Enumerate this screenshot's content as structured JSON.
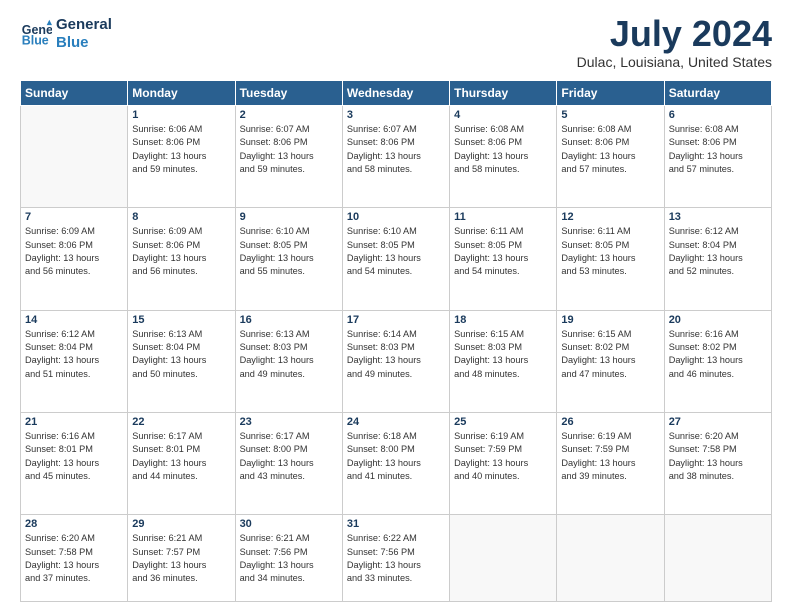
{
  "header": {
    "logo_line1": "General",
    "logo_line2": "Blue",
    "month_title": "July 2024",
    "location": "Dulac, Louisiana, United States"
  },
  "weekdays": [
    "Sunday",
    "Monday",
    "Tuesday",
    "Wednesday",
    "Thursday",
    "Friday",
    "Saturday"
  ],
  "weeks": [
    [
      {
        "day": "",
        "info": ""
      },
      {
        "day": "1",
        "info": "Sunrise: 6:06 AM\nSunset: 8:06 PM\nDaylight: 13 hours\nand 59 minutes."
      },
      {
        "day": "2",
        "info": "Sunrise: 6:07 AM\nSunset: 8:06 PM\nDaylight: 13 hours\nand 59 minutes."
      },
      {
        "day": "3",
        "info": "Sunrise: 6:07 AM\nSunset: 8:06 PM\nDaylight: 13 hours\nand 58 minutes."
      },
      {
        "day": "4",
        "info": "Sunrise: 6:08 AM\nSunset: 8:06 PM\nDaylight: 13 hours\nand 58 minutes."
      },
      {
        "day": "5",
        "info": "Sunrise: 6:08 AM\nSunset: 8:06 PM\nDaylight: 13 hours\nand 57 minutes."
      },
      {
        "day": "6",
        "info": "Sunrise: 6:08 AM\nSunset: 8:06 PM\nDaylight: 13 hours\nand 57 minutes."
      }
    ],
    [
      {
        "day": "7",
        "info": "Sunrise: 6:09 AM\nSunset: 8:06 PM\nDaylight: 13 hours\nand 56 minutes."
      },
      {
        "day": "8",
        "info": "Sunrise: 6:09 AM\nSunset: 8:06 PM\nDaylight: 13 hours\nand 56 minutes."
      },
      {
        "day": "9",
        "info": "Sunrise: 6:10 AM\nSunset: 8:05 PM\nDaylight: 13 hours\nand 55 minutes."
      },
      {
        "day": "10",
        "info": "Sunrise: 6:10 AM\nSunset: 8:05 PM\nDaylight: 13 hours\nand 54 minutes."
      },
      {
        "day": "11",
        "info": "Sunrise: 6:11 AM\nSunset: 8:05 PM\nDaylight: 13 hours\nand 54 minutes."
      },
      {
        "day": "12",
        "info": "Sunrise: 6:11 AM\nSunset: 8:05 PM\nDaylight: 13 hours\nand 53 minutes."
      },
      {
        "day": "13",
        "info": "Sunrise: 6:12 AM\nSunset: 8:04 PM\nDaylight: 13 hours\nand 52 minutes."
      }
    ],
    [
      {
        "day": "14",
        "info": "Sunrise: 6:12 AM\nSunset: 8:04 PM\nDaylight: 13 hours\nand 51 minutes."
      },
      {
        "day": "15",
        "info": "Sunrise: 6:13 AM\nSunset: 8:04 PM\nDaylight: 13 hours\nand 50 minutes."
      },
      {
        "day": "16",
        "info": "Sunrise: 6:13 AM\nSunset: 8:03 PM\nDaylight: 13 hours\nand 49 minutes."
      },
      {
        "day": "17",
        "info": "Sunrise: 6:14 AM\nSunset: 8:03 PM\nDaylight: 13 hours\nand 49 minutes."
      },
      {
        "day": "18",
        "info": "Sunrise: 6:15 AM\nSunset: 8:03 PM\nDaylight: 13 hours\nand 48 minutes."
      },
      {
        "day": "19",
        "info": "Sunrise: 6:15 AM\nSunset: 8:02 PM\nDaylight: 13 hours\nand 47 minutes."
      },
      {
        "day": "20",
        "info": "Sunrise: 6:16 AM\nSunset: 8:02 PM\nDaylight: 13 hours\nand 46 minutes."
      }
    ],
    [
      {
        "day": "21",
        "info": "Sunrise: 6:16 AM\nSunset: 8:01 PM\nDaylight: 13 hours\nand 45 minutes."
      },
      {
        "day": "22",
        "info": "Sunrise: 6:17 AM\nSunset: 8:01 PM\nDaylight: 13 hours\nand 44 minutes."
      },
      {
        "day": "23",
        "info": "Sunrise: 6:17 AM\nSunset: 8:00 PM\nDaylight: 13 hours\nand 43 minutes."
      },
      {
        "day": "24",
        "info": "Sunrise: 6:18 AM\nSunset: 8:00 PM\nDaylight: 13 hours\nand 41 minutes."
      },
      {
        "day": "25",
        "info": "Sunrise: 6:19 AM\nSunset: 7:59 PM\nDaylight: 13 hours\nand 40 minutes."
      },
      {
        "day": "26",
        "info": "Sunrise: 6:19 AM\nSunset: 7:59 PM\nDaylight: 13 hours\nand 39 minutes."
      },
      {
        "day": "27",
        "info": "Sunrise: 6:20 AM\nSunset: 7:58 PM\nDaylight: 13 hours\nand 38 minutes."
      }
    ],
    [
      {
        "day": "28",
        "info": "Sunrise: 6:20 AM\nSunset: 7:58 PM\nDaylight: 13 hours\nand 37 minutes."
      },
      {
        "day": "29",
        "info": "Sunrise: 6:21 AM\nSunset: 7:57 PM\nDaylight: 13 hours\nand 36 minutes."
      },
      {
        "day": "30",
        "info": "Sunrise: 6:21 AM\nSunset: 7:56 PM\nDaylight: 13 hours\nand 34 minutes."
      },
      {
        "day": "31",
        "info": "Sunrise: 6:22 AM\nSunset: 7:56 PM\nDaylight: 13 hours\nand 33 minutes."
      },
      {
        "day": "",
        "info": ""
      },
      {
        "day": "",
        "info": ""
      },
      {
        "day": "",
        "info": ""
      }
    ]
  ]
}
